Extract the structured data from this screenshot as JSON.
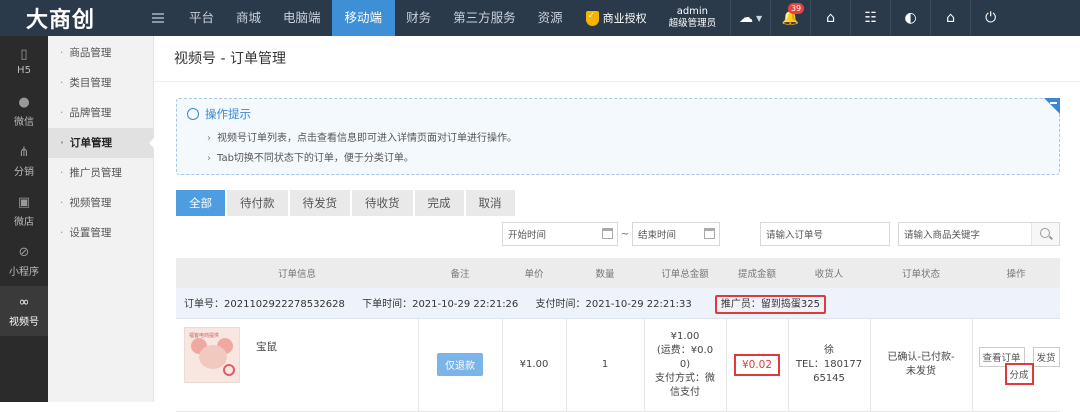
{
  "logo": "大商创",
  "topnav": [
    "平台",
    "商城",
    "电脑端",
    "移动端",
    "财务",
    "第三方服务",
    "资源"
  ],
  "topnav_active": 3,
  "business_auth": "商业授权",
  "admin": {
    "name": "admin",
    "role": "超级管理员"
  },
  "notification_count": "39",
  "rail": [
    {
      "label": "H5",
      "icon": "phone-icon"
    },
    {
      "label": "微信",
      "icon": "wechat-icon"
    },
    {
      "label": "分销",
      "icon": "network-icon"
    },
    {
      "label": "微店",
      "icon": "store-icon"
    },
    {
      "label": "小程序",
      "icon": "miniprogram-icon"
    },
    {
      "label": "视频号",
      "icon": "video-channel-icon"
    }
  ],
  "subnav": [
    "商品管理",
    "类目管理",
    "品牌管理",
    "订单管理",
    "推广员管理",
    "视频管理",
    "设置管理"
  ],
  "subnav_active": 3,
  "page_title": "视频号 - 订单管理",
  "tips": {
    "title": "操作提示",
    "lines": [
      "视频号订单列表，点击查看信息即可进入详情页面对订单进行操作。",
      "Tab切换不同状态下的订单，便于分类订单。"
    ]
  },
  "tabs": [
    "全部",
    "待付款",
    "待发货",
    "待收货",
    "完成",
    "取消"
  ],
  "tabs_active": 0,
  "filters": {
    "start_time": "开始时间",
    "tilde": "~",
    "end_time": "结束时间",
    "order_no": "请输入订单号",
    "keyword": "请输入商品关键字"
  },
  "table": {
    "headers": [
      "订单信息",
      "备注",
      "单价",
      "数量",
      "订单总金额",
      "提成金额",
      "收货人",
      "订单状态",
      "操作"
    ],
    "order": {
      "order_no": "订单号：2021102922278532628",
      "order_time": "下单时间：2021-10-29 22:21:26",
      "pay_time": "支付时间：2021-10-29 22:21:33",
      "promoter": "推广员：留到捣蛋325"
    },
    "item": {
      "thumb_caption": "福客电商提供",
      "name": "宝鼠",
      "refund": "仅退款",
      "price": "¥1.00",
      "qty": "1",
      "total_lines": [
        "¥1.00",
        "(运费：¥0.0",
        "0)",
        "支付方式：微",
        "信支付"
      ],
      "commission": "¥0.02",
      "receiver_lines": [
        "徐",
        "TEL：180177",
        "65145"
      ],
      "status_lines": [
        "已确认-已付款-",
        "未发货"
      ],
      "ops": {
        "view": "查看订单",
        "ship": "发货",
        "split": "分成"
      }
    }
  }
}
